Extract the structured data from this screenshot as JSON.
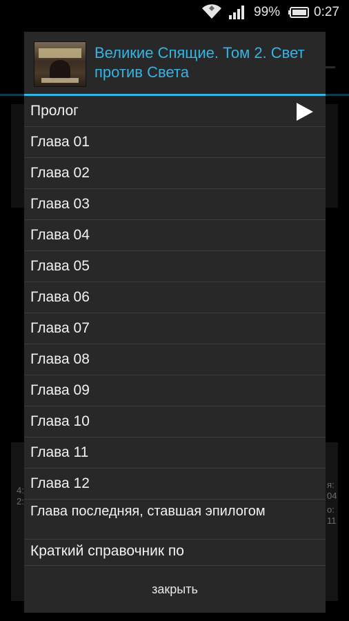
{
  "status_bar": {
    "battery_text": "99%",
    "time": "0:27",
    "icons": [
      "wifi-icon",
      "signal-icon",
      "battery-icon"
    ]
  },
  "background": {
    "frag_left_1": "4:",
    "frag_left_2": "2:",
    "frag_right_1": "я:",
    "frag_right_2": "04",
    "frag_right_3": "o:",
    "frag_right_4": "11"
  },
  "dialog": {
    "title": "Великие Спящие. Том 2. Свет против Света",
    "accent_color": "#33b5e5",
    "cover_icon": "book-cover-image",
    "chapters": [
      {
        "label": "Пролог",
        "playing": true
      },
      {
        "label": "Глава 01"
      },
      {
        "label": "Глава 02"
      },
      {
        "label": "Глава 03"
      },
      {
        "label": "Глава 04"
      },
      {
        "label": "Глава 05"
      },
      {
        "label": "Глава 06"
      },
      {
        "label": "Глава 07"
      },
      {
        "label": "Глава 08"
      },
      {
        "label": "Глава 09"
      },
      {
        "label": "Глава 10"
      },
      {
        "label": "Глава 11"
      },
      {
        "label": "Глава 12"
      },
      {
        "label": "Глава последняя, ставшая эпилогом"
      },
      {
        "label": "Краткий справочник по"
      }
    ],
    "close_label": "закрыть"
  }
}
